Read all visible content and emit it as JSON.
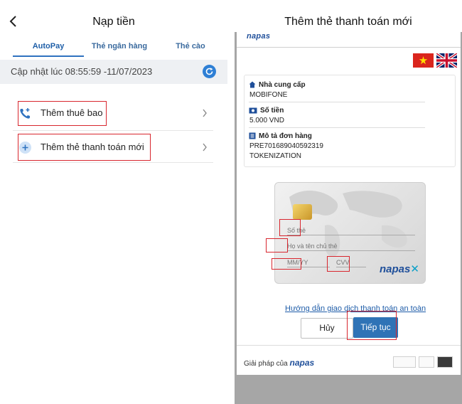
{
  "left_panel": {
    "title": "Nạp tiền",
    "tabs": [
      "AutoPay",
      "Thẻ ngân hàng",
      "Thẻ cào"
    ],
    "update_text": "Cập nhật lúc 08:55:59 -11/07/2023",
    "items": [
      {
        "label": "Thêm thuê bao"
      },
      {
        "label": "Thêm thẻ thanh toán mới"
      }
    ]
  },
  "right_panel": {
    "title": "Thêm thẻ thanh toán mới",
    "brand": "napas",
    "provider_label": "Nhà cung cấp",
    "provider_value": "MOBIFONE",
    "amount_label": "Số tiền",
    "amount_value": "5.000 VND",
    "order_label": "Mô tả đơn hàng",
    "order_id": "PRE701689040592319",
    "order_type": "TOKENIZATION",
    "card": {
      "number_placeholder": "Số thẻ",
      "name_placeholder": "Họ và tên chủ thẻ",
      "expiry_placeholder": "MM/YY",
      "cvv_placeholder": "CVV",
      "brand": "napas"
    },
    "guide_link": "Hướng dẫn giao dịch thanh toán an toàn",
    "cancel_label": "Hủy",
    "continue_label": "Tiếp tục",
    "footer_text": "Giải pháp của",
    "footer_brand": "napas"
  },
  "colors": {
    "accent_blue": "#2f73b6",
    "highlight_red": "#d8262e",
    "napas_blue": "#1f4f9a"
  }
}
